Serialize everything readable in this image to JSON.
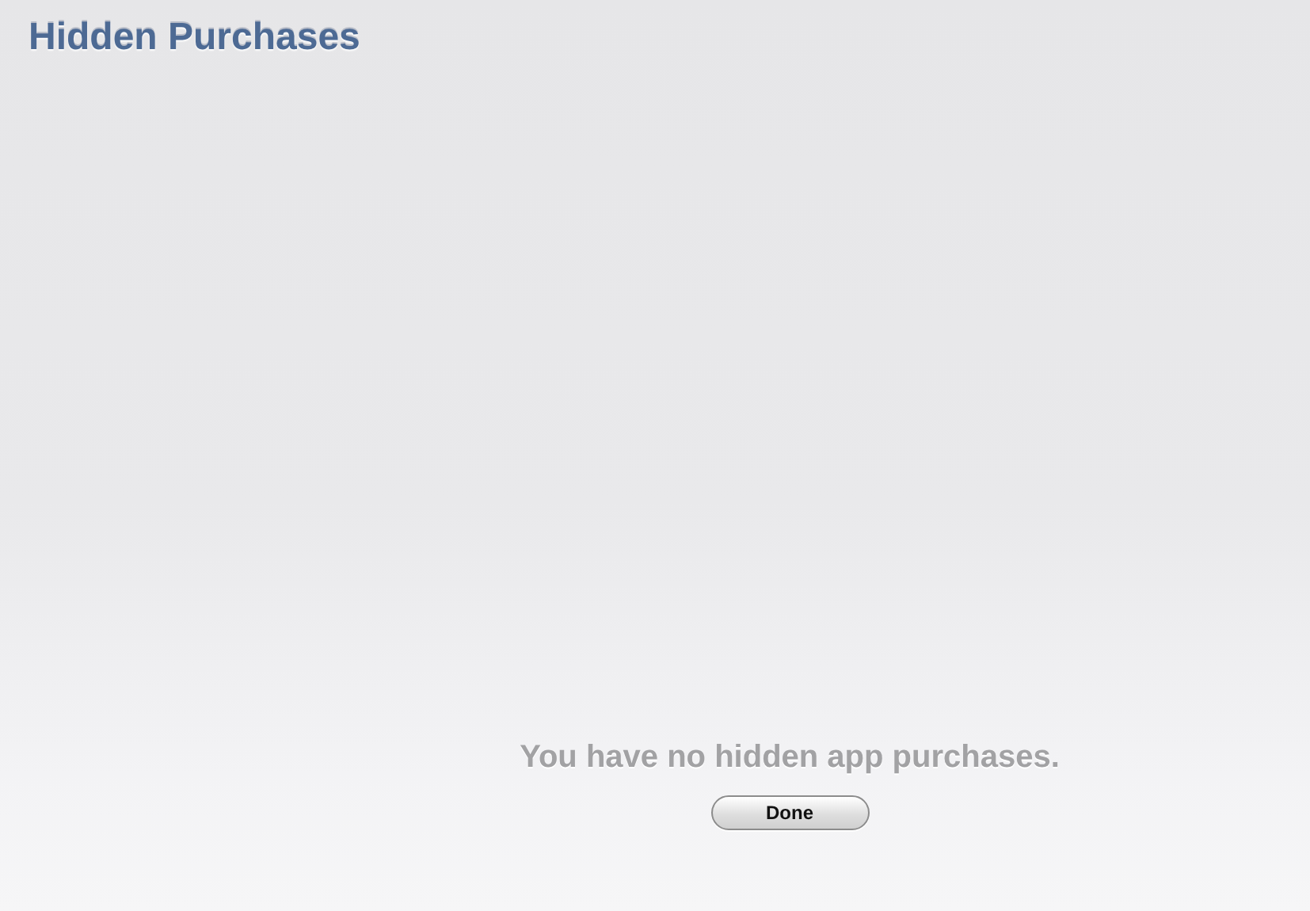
{
  "title": "Hidden Purchases",
  "message": "You have no hidden app purchases.",
  "buttons": [
    "Done"
  ]
}
